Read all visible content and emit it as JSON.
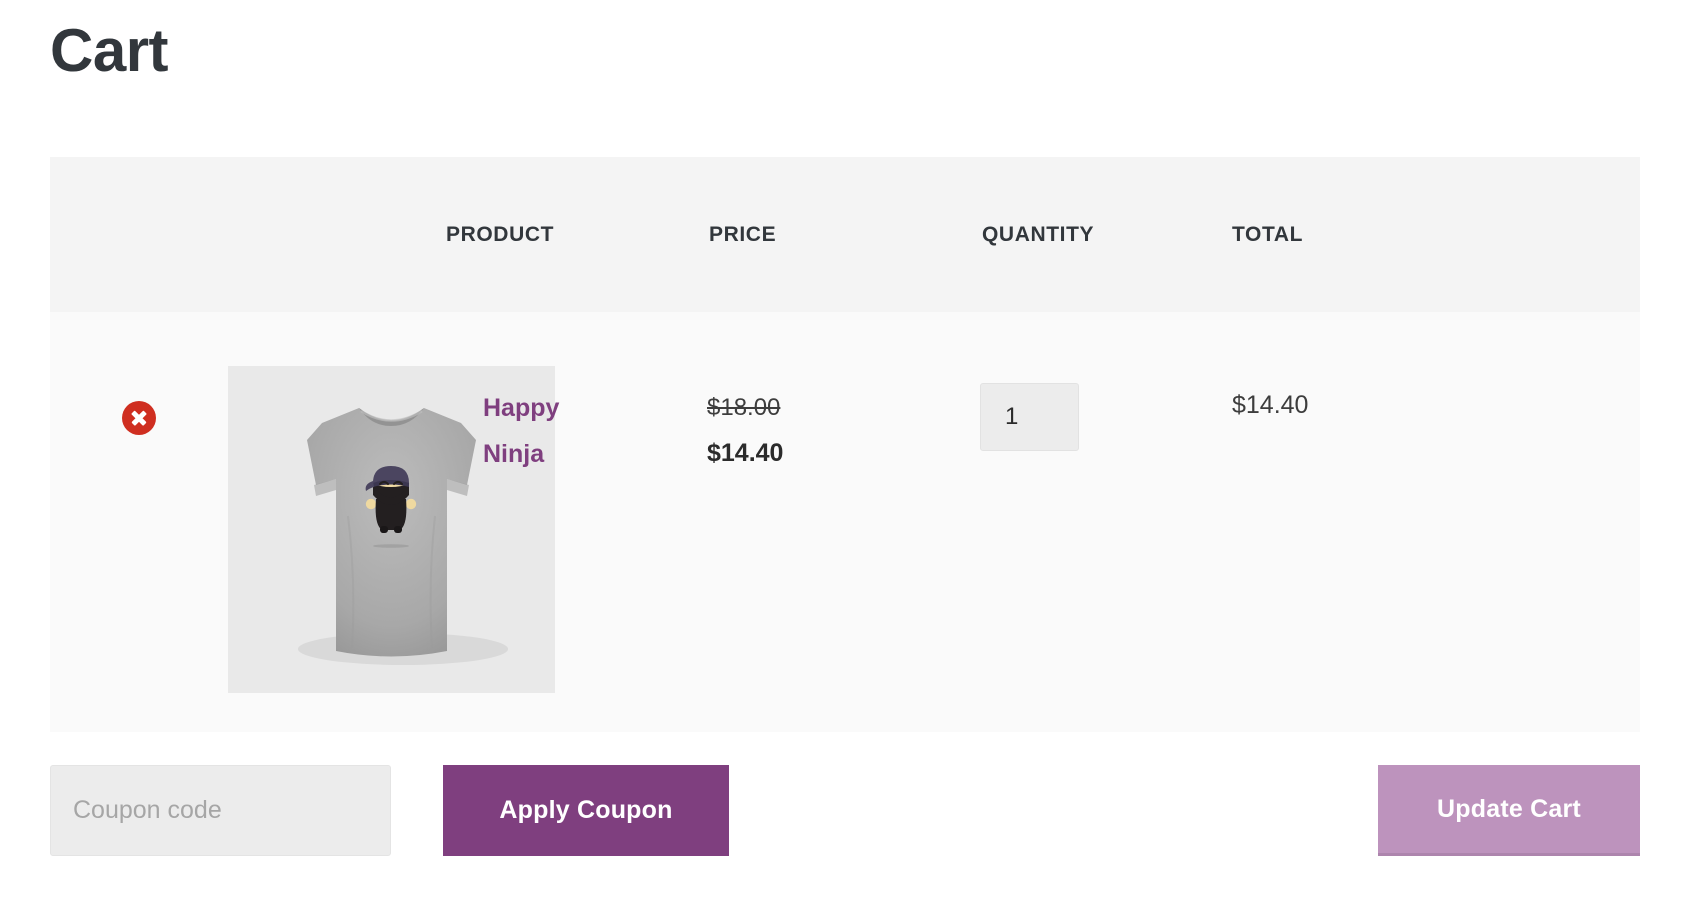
{
  "page": {
    "title": "Cart"
  },
  "table": {
    "headers": {
      "remove": "",
      "thumbnail": "",
      "product": "PRODUCT",
      "price": "PRICE",
      "quantity": "QUANTITY",
      "total": "TOTAL"
    },
    "rows": [
      {
        "remove_label": "×",
        "product_name": "Happy Ninja",
        "thumbnail_alt": "Happy Ninja t-shirt",
        "price_regular": "$18.00",
        "price_sale": "$14.40",
        "quantity": "1",
        "line_total": "$14.40"
      }
    ]
  },
  "actions": {
    "coupon_placeholder": "Coupon code",
    "coupon_value": "",
    "apply_coupon_label": "Apply Coupon",
    "update_cart_label": "Update Cart"
  },
  "colors": {
    "accent_purple": "#7f3f7f",
    "accent_purple_muted": "#bd93bd",
    "remove_red": "#cf2e20",
    "header_bg": "#f4f4f4",
    "row_bg": "#fafafa",
    "text_dark": "#32373c"
  }
}
